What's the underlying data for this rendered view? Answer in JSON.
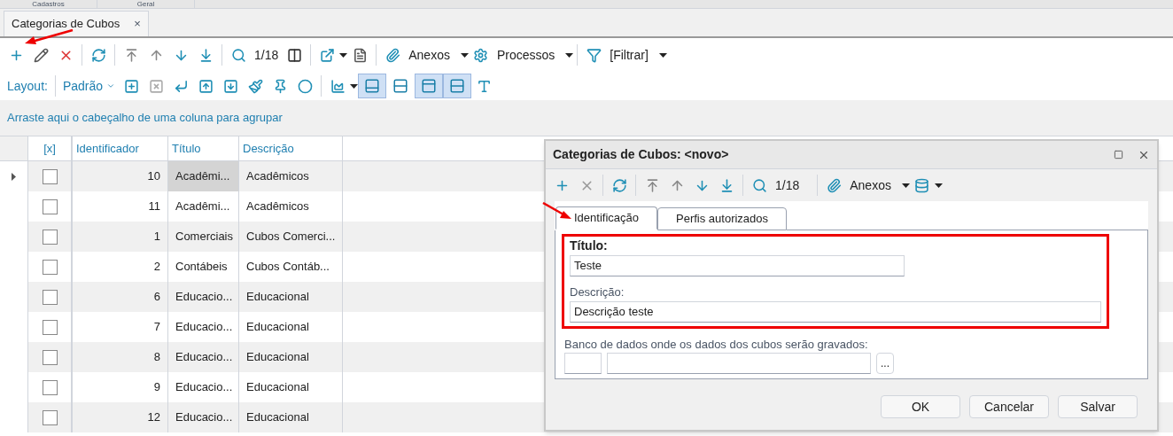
{
  "top_menu": [
    "Cadastros",
    "Geral"
  ],
  "doc_tab": {
    "title": "Categorias de Cubos",
    "close": "×"
  },
  "toolbar": {
    "record": "1/18",
    "attachments": "Anexos",
    "processes": "Processos",
    "filter": "[Filtrar]"
  },
  "layout_bar": {
    "label": "Layout:",
    "layout": "Padrão",
    "toggles": [
      {
        "pressed": true
      },
      {
        "pressed": false
      },
      {
        "pressed": true
      },
      {
        "pressed": true
      }
    ]
  },
  "group_hint": "Arraste aqui o cabeçalho de uma coluna para agrupar",
  "table": {
    "columns": [
      "[x]",
      "Identificador",
      "Título",
      "Descrição"
    ],
    "rows": [
      {
        "current": true,
        "checked": false,
        "id": "10",
        "title": "Acadêmi...",
        "description": "Acadêmicos"
      },
      {
        "current": false,
        "checked": false,
        "id": "11",
        "title": "Acadêmi...",
        "description": "Acadêmicos"
      },
      {
        "current": false,
        "checked": false,
        "id": "1",
        "title": "Comerciais",
        "description": "Cubos Comerci..."
      },
      {
        "current": false,
        "checked": false,
        "id": "2",
        "title": "Contábeis",
        "description": "Cubos Contáb..."
      },
      {
        "current": false,
        "checked": false,
        "id": "6",
        "title": "Educacio...",
        "description": "Educacional"
      },
      {
        "current": false,
        "checked": false,
        "id": "7",
        "title": "Educacio...",
        "description": "Educacional"
      },
      {
        "current": false,
        "checked": false,
        "id": "8",
        "title": "Educacio...",
        "description": "Educacional"
      },
      {
        "current": false,
        "checked": false,
        "id": "9",
        "title": "Educacio...",
        "description": "Educacional"
      },
      {
        "current": false,
        "checked": false,
        "id": "12",
        "title": "Educacio...",
        "description": "Educacional"
      }
    ]
  },
  "dialog": {
    "title": "Categorias de Cubos: <novo>",
    "record": "1/18",
    "attachments": "Anexos",
    "tabs": [
      {
        "label": "Identificação",
        "selected": true
      },
      {
        "label": "Perfis autorizados",
        "selected": false
      }
    ],
    "fields": {
      "title_label": "Título:",
      "title_value": "Teste",
      "description_label": "Descrição:",
      "description_value": "Descrição teste",
      "database_label": "Banco de dados onde os dados dos cubos serão gravados:",
      "browse": "..."
    },
    "buttons": [
      "OK",
      "Cancelar",
      "Salvar"
    ]
  }
}
